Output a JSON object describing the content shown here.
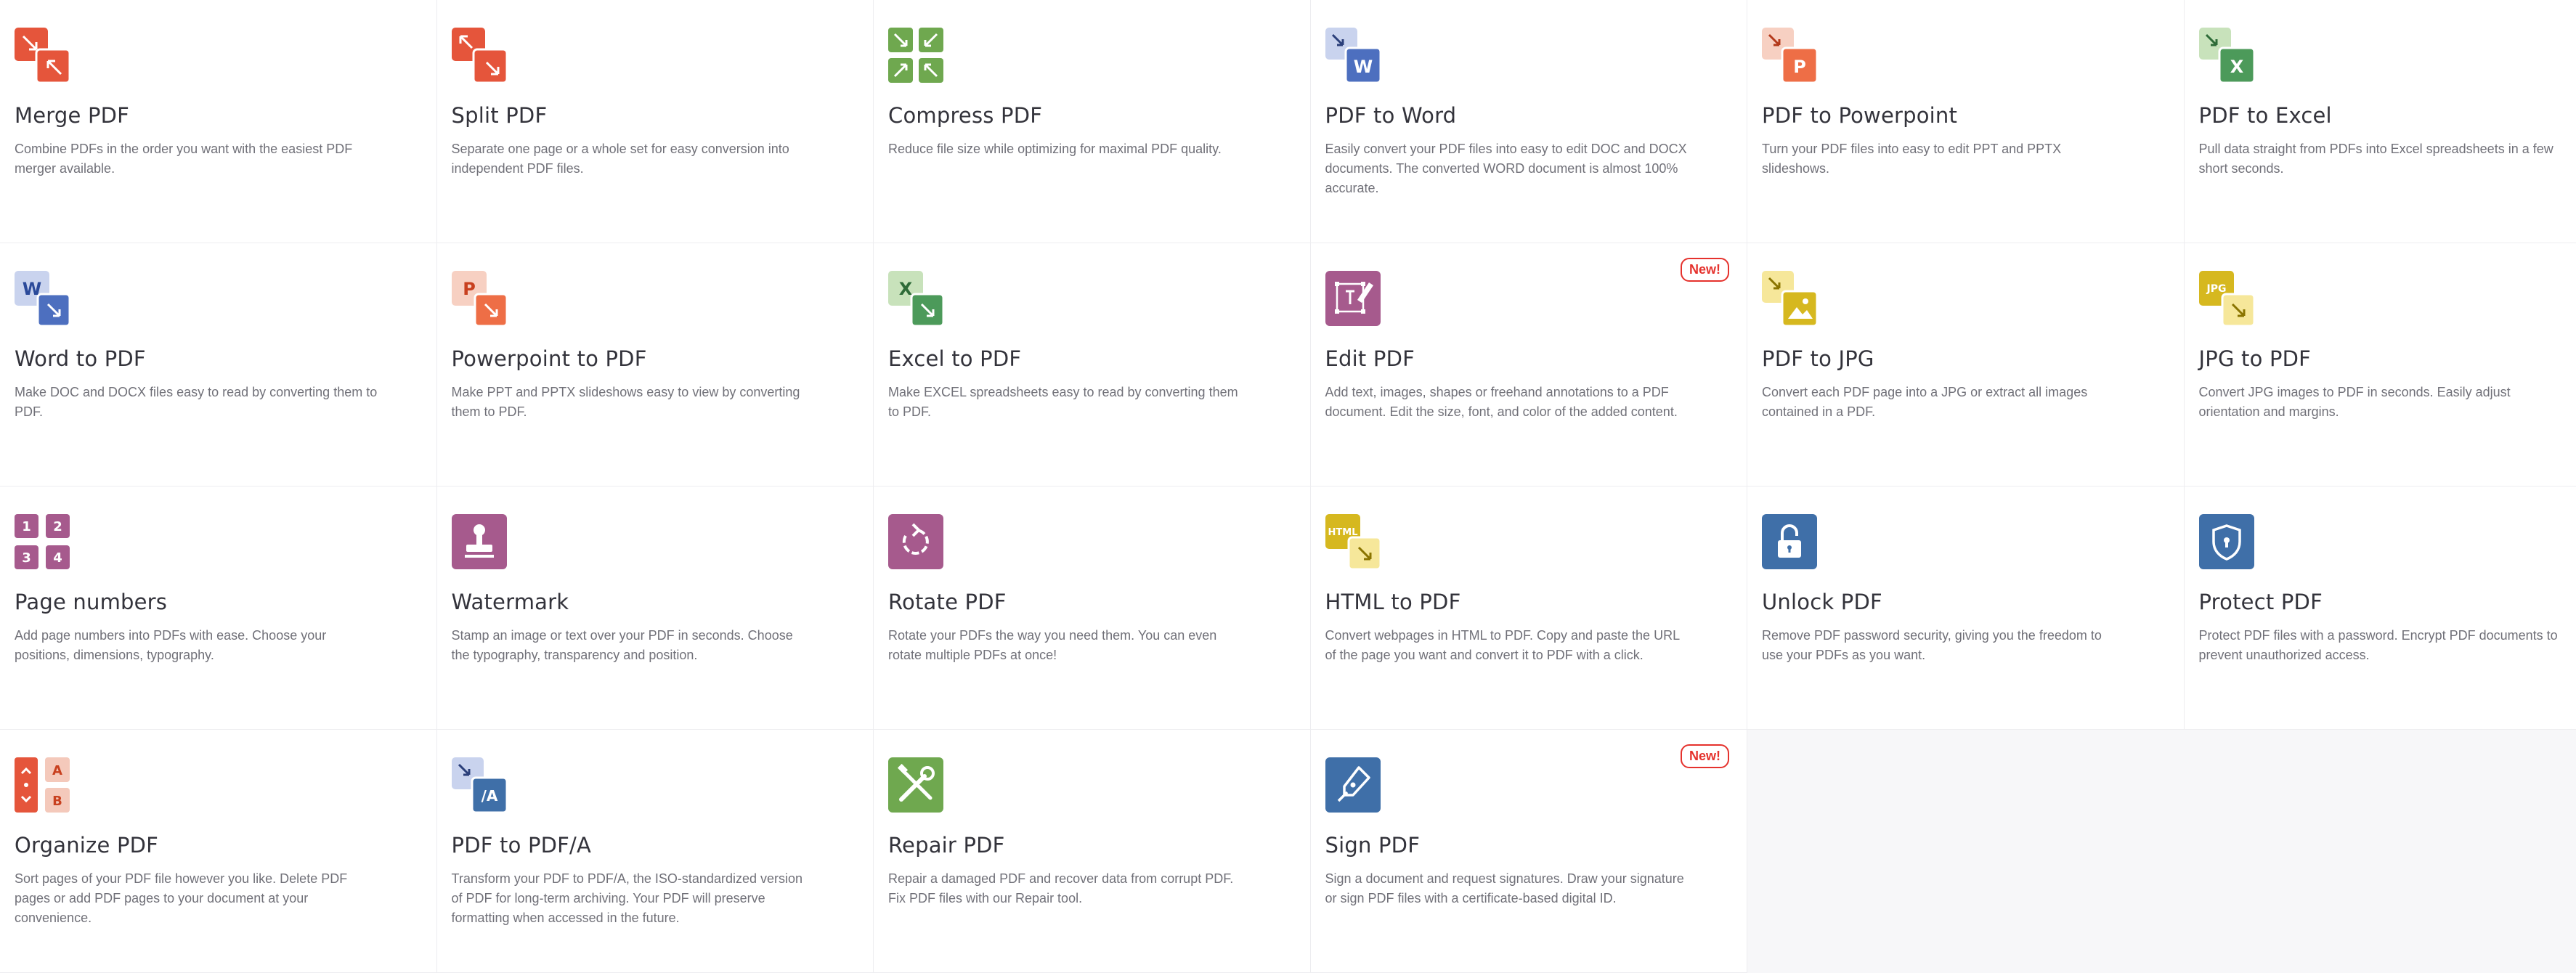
{
  "tools": [
    {
      "id": "merge",
      "icon": "merge-pdf-icon",
      "title": "Merge PDF",
      "desc": "Combine PDFs in the order you want with the easiest PDF merger available.",
      "badge": ""
    },
    {
      "id": "split",
      "icon": "split-pdf-icon",
      "title": "Split PDF",
      "desc": "Separate one page or a whole set for easy conversion into independent PDF files.",
      "badge": ""
    },
    {
      "id": "compress",
      "icon": "compress-pdf-icon",
      "title": "Compress PDF",
      "desc": "Reduce file size while optimizing for maximal PDF quality.",
      "badge": ""
    },
    {
      "id": "pdf-word",
      "icon": "pdf-to-word-icon",
      "title": "PDF to Word",
      "desc": "Easily convert your PDF files into easy to edit DOC and DOCX documents. The converted WORD document is almost 100% accurate.",
      "badge": "",
      "glyph": "W"
    },
    {
      "id": "pdf-ppt",
      "icon": "pdf-to-powerpoint-icon",
      "title": "PDF to Powerpoint",
      "desc": "Turn your PDF files into easy to edit PPT and PPTX slideshows.",
      "badge": "",
      "glyph": "P"
    },
    {
      "id": "pdf-excel",
      "icon": "pdf-to-excel-icon",
      "title": "PDF to Excel",
      "desc": "Pull data straight from PDFs into Excel spreadsheets in a few short seconds.",
      "badge": "",
      "glyph": "X"
    },
    {
      "id": "word-pdf",
      "icon": "word-to-pdf-icon",
      "title": "Word to PDF",
      "desc": "Make DOC and DOCX files easy to read by converting them to PDF.",
      "badge": "",
      "glyph": "W"
    },
    {
      "id": "ppt-pdf",
      "icon": "powerpoint-to-pdf-icon",
      "title": "Powerpoint to PDF",
      "desc": "Make PPT and PPTX slideshows easy to view by converting them to PDF.",
      "badge": "",
      "glyph": "P"
    },
    {
      "id": "excel-pdf",
      "icon": "excel-to-pdf-icon",
      "title": "Excel to PDF",
      "desc": "Make EXCEL spreadsheets easy to read by converting them to PDF.",
      "badge": "",
      "glyph": "X"
    },
    {
      "id": "edit",
      "icon": "edit-pdf-icon",
      "title": "Edit PDF",
      "desc": "Add text, images, shapes or freehand annotations to a PDF document. Edit the size, font, and color of the added content.",
      "badge": "New!"
    },
    {
      "id": "pdf-jpg",
      "icon": "pdf-to-jpg-icon",
      "title": "PDF to JPG",
      "desc": "Convert each PDF page into a JPG or extract all images contained in a PDF.",
      "badge": ""
    },
    {
      "id": "jpg-pdf",
      "icon": "jpg-to-pdf-icon",
      "title": "JPG to PDF",
      "desc": "Convert JPG images to PDF in seconds. Easily adjust orientation and margins.",
      "badge": "",
      "glyph": "JPG"
    },
    {
      "id": "numbers",
      "icon": "page-numbers-icon",
      "title": "Page numbers",
      "desc": "Add page numbers into PDFs with ease. Choose your positions, dimensions, typography.",
      "badge": "",
      "digits": [
        "1",
        "2",
        "3",
        "4"
      ]
    },
    {
      "id": "watermark",
      "icon": "watermark-stamp-icon",
      "title": "Watermark",
      "desc": "Stamp an image or text over your PDF in seconds. Choose the typography, transparency and position.",
      "badge": ""
    },
    {
      "id": "rotate",
      "icon": "rotate-pdf-icon",
      "title": "Rotate PDF",
      "desc": "Rotate your PDFs the way you need them. You can even rotate multiple PDFs at once!",
      "badge": ""
    },
    {
      "id": "html-pdf",
      "icon": "html-to-pdf-icon",
      "title": "HTML to PDF",
      "desc": "Convert webpages in HTML to PDF. Copy and paste the URL of the page you want and convert it to PDF with a click.",
      "badge": "",
      "glyph": "HTML"
    },
    {
      "id": "unlock",
      "icon": "unlock-padlock-icon",
      "title": "Unlock PDF",
      "desc": "Remove PDF password security, giving you the freedom to use your PDFs as you want.",
      "badge": ""
    },
    {
      "id": "protect",
      "icon": "protect-shield-icon",
      "title": "Protect PDF",
      "desc": "Protect PDF files with a password. Encrypt PDF documents to prevent unauthorized access.",
      "badge": ""
    },
    {
      "id": "organize",
      "icon": "organize-pdf-icon",
      "title": "Organize PDF",
      "desc": "Sort pages of your PDF file however you like. Delete PDF pages or add PDF pages to your document at your convenience.",
      "badge": "",
      "letters": [
        "A",
        "B"
      ]
    },
    {
      "id": "pdfa",
      "icon": "pdf-to-pdfa-icon",
      "title": "PDF to PDF/A",
      "desc": "Transform your PDF to PDF/A, the ISO-standardized version of PDF for long-term archiving. Your PDF will preserve formatting when accessed in the future.",
      "badge": "",
      "glyph": "/A"
    },
    {
      "id": "repair",
      "icon": "repair-tools-icon",
      "title": "Repair PDF",
      "desc": "Repair a damaged PDF and recover data from corrupt PDF. Fix PDF files with our Repair tool.",
      "badge": ""
    },
    {
      "id": "sign",
      "icon": "sign-pen-icon",
      "title": "Sign PDF",
      "desc": "Sign a document and request signatures. Draw your signature or sign PDF files with a certificate-based digital ID.",
      "badge": "New!"
    }
  ],
  "colors": {
    "red": "#e5553b",
    "redLight": "#f4c9bb",
    "green": "#6fa84f",
    "greenLight": "#c8e2bb",
    "blue": "#4d6fbf",
    "blueLight": "#c9d3ee",
    "orange": "#ee6e46",
    "orangeLight": "#f7d0c2",
    "excelGreen": "#4c9a5a",
    "purple": "#a65a8d",
    "yellow": "#d6b81f",
    "yellowLight": "#f6e79a",
    "steel": "#3f6fa8",
    "badge": "#e5322d"
  }
}
